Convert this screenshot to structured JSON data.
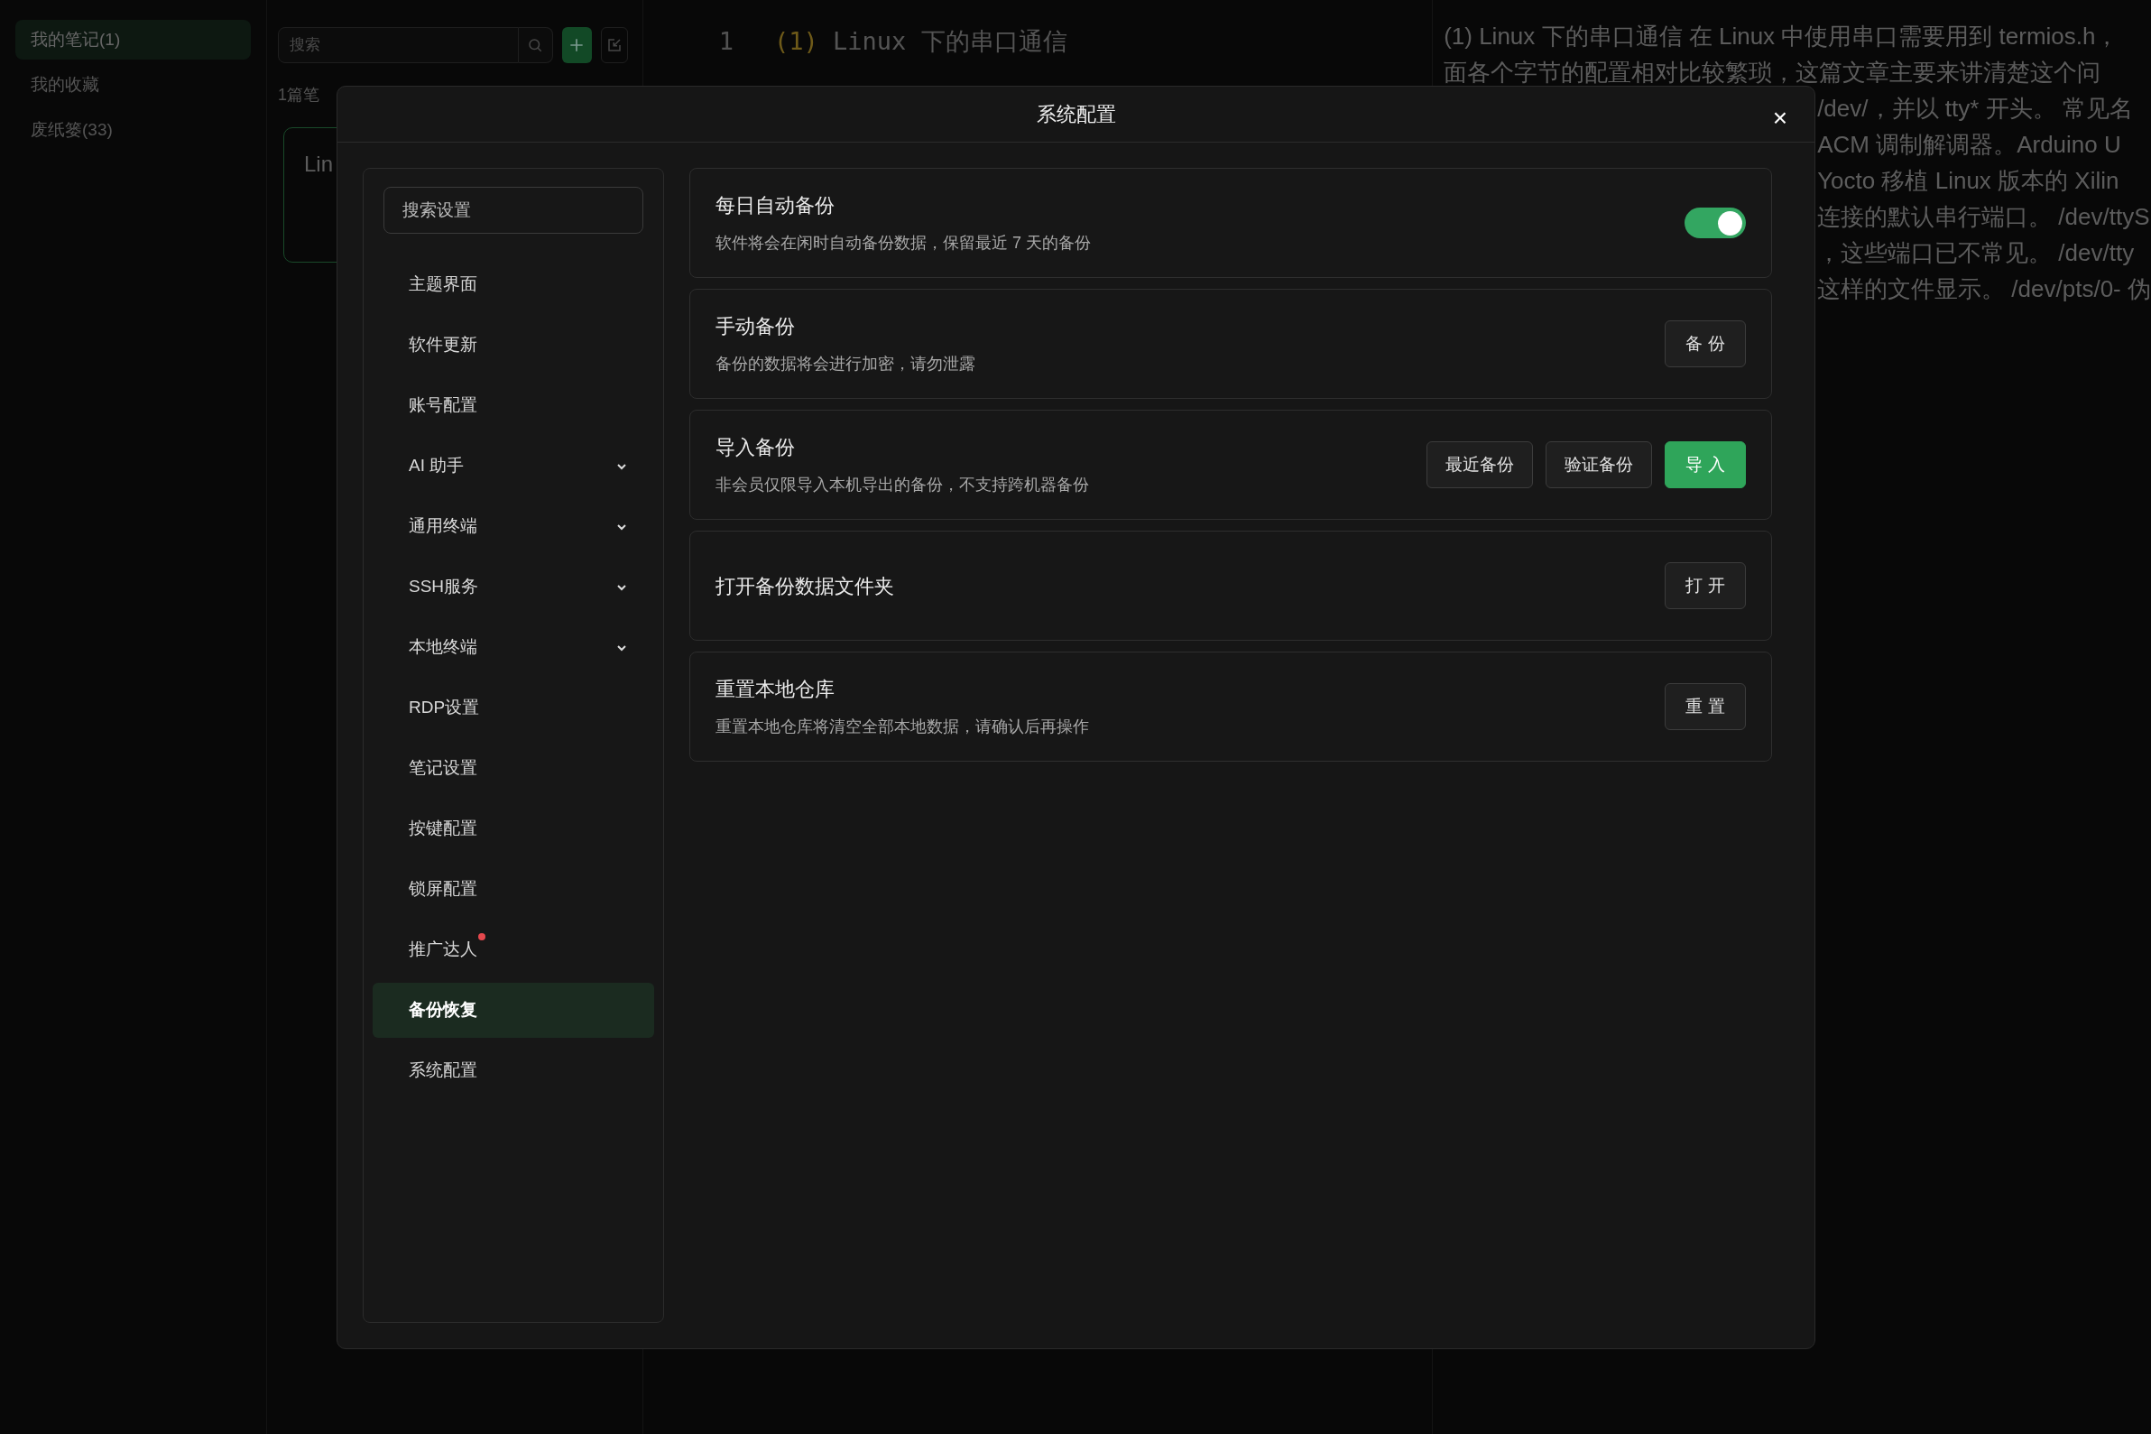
{
  "sidebar": {
    "items": [
      {
        "label": "我的笔记(1)",
        "selected": true
      },
      {
        "label": "我的收藏",
        "selected": false
      },
      {
        "label": "废纸篓(33)",
        "selected": false
      }
    ]
  },
  "note_list": {
    "search": {
      "placeholder": "搜索"
    },
    "count": "1篇笔",
    "notes": [
      {
        "title": "Lin",
        "selected": true
      }
    ]
  },
  "editor": {
    "lines": [
      {
        "number": "1",
        "prefix": "(1)",
        "text": "Linux 下的串口通信"
      }
    ]
  },
  "preview": {
    "lines": [
      "(1) Linux 下的串口通信 在 Linux 中使用串口需要用到 termios.h，",
      "面各个字节的配置相对比较繁琐，这篇文章主要来讲清楚这个问",
      "/dev/，并以 tty* 开头。 常见名",
      "ACM 调制解调器。Arduino U",
      "Yocto 移植 Linux 版本的 Xilin",
      "连接的默认串行端口。 /dev/ttyS",
      "，这些端口已不常见。 /dev/tty",
      "这样的文件显示。 /dev/pts/0- 伪"
    ]
  },
  "dialog": {
    "title": "系统配置",
    "close": "×",
    "search": {
      "placeholder": "搜索设置"
    },
    "nav": [
      {
        "label": "主题界面",
        "expandable": false,
        "badge": false,
        "selected": false
      },
      {
        "label": "软件更新",
        "expandable": false,
        "badge": false,
        "selected": false
      },
      {
        "label": "账号配置",
        "expandable": false,
        "badge": false,
        "selected": false
      },
      {
        "label": "AI 助手",
        "expandable": true,
        "badge": false,
        "selected": false
      },
      {
        "label": "通用终端",
        "expandable": true,
        "badge": false,
        "selected": false
      },
      {
        "label": "SSH服务",
        "expandable": true,
        "badge": false,
        "selected": false
      },
      {
        "label": "本地终端",
        "expandable": true,
        "badge": false,
        "selected": false
      },
      {
        "label": "RDP设置",
        "expandable": false,
        "badge": false,
        "selected": false
      },
      {
        "label": "笔记设置",
        "expandable": false,
        "badge": false,
        "selected": false
      },
      {
        "label": "按键配置",
        "expandable": false,
        "badge": false,
        "selected": false
      },
      {
        "label": "锁屏配置",
        "expandable": false,
        "badge": false,
        "selected": false
      },
      {
        "label": "推广达人",
        "expandable": false,
        "badge": true,
        "selected": false
      },
      {
        "label": "备份恢复",
        "expandable": false,
        "badge": false,
        "selected": true
      },
      {
        "label": "系统配置",
        "expandable": false,
        "badge": false,
        "selected": false
      }
    ],
    "sections": [
      {
        "title": "每日自动备份",
        "description": "软件将会在闲时自动备份数据，保留最近 7 天的备份",
        "controls": [
          {
            "kind": "toggle",
            "on": true
          }
        ]
      },
      {
        "title": "手动备份",
        "description": "备份的数据将会进行加密，请勿泄露",
        "controls": [
          {
            "kind": "button",
            "label": "备 份",
            "primary": false
          }
        ]
      },
      {
        "title": "导入备份",
        "description": "非会员仅限导入本机导出的备份，不支持跨机器备份",
        "controls": [
          {
            "kind": "button",
            "label": "最近备份",
            "primary": false
          },
          {
            "kind": "button",
            "label": "验证备份",
            "primary": false
          },
          {
            "kind": "button",
            "label": "导 入",
            "primary": true
          }
        ]
      },
      {
        "title": "打开备份数据文件夹",
        "controls": [
          {
            "kind": "button",
            "label": "打 开",
            "primary": false
          }
        ]
      },
      {
        "title": "重置本地仓库",
        "description": "重置本地仓库将清空全部本地数据，请确认后再操作",
        "controls": [
          {
            "kind": "button",
            "label": "重 置",
            "primary": false
          }
        ]
      }
    ]
  }
}
